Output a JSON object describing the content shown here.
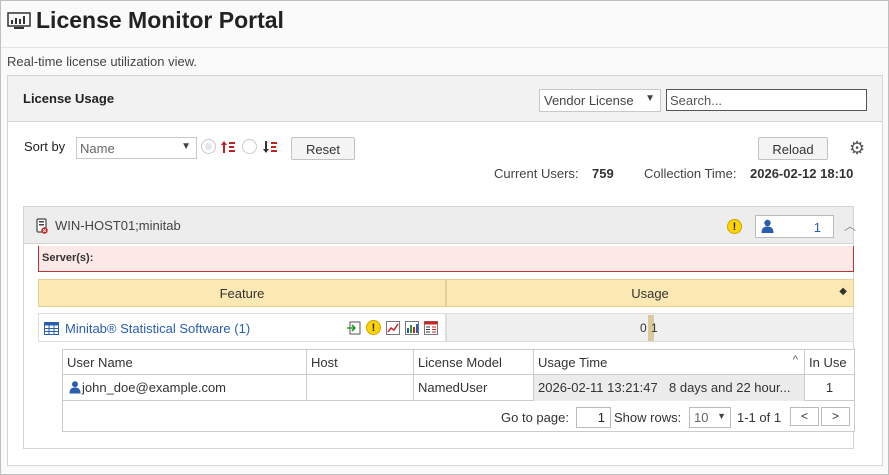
{
  "header": {
    "title": "License Monitor Portal",
    "subtitle": "Real-time license utilization view."
  },
  "panel": {
    "title": "License Usage",
    "vendor_select": "Vendor License",
    "search_placeholder": "Search..."
  },
  "controls": {
    "sort_label": "Sort by",
    "sort_value": "Name",
    "reset_label": "Reset",
    "reload_label": "Reload"
  },
  "stats": {
    "current_users_label": "Current Users:",
    "current_users_value": "759",
    "collection_time_label": "Collection Time:",
    "collection_time_value": "2026-02-12 18:10"
  },
  "server": {
    "name": "WIN-HOST01;minitab",
    "user_count": "1",
    "servers_label": "Server(s):"
  },
  "features": {
    "columns": [
      "Feature",
      "Usage"
    ],
    "rows": [
      {
        "name": "Minitab® Statistical Software (1)",
        "usage_in_use": "0",
        "usage_total": "1"
      }
    ]
  },
  "user_table": {
    "columns": [
      "User Name",
      "Host",
      "License Model",
      "Usage Time",
      "In Use"
    ],
    "rows": [
      {
        "user": "john_doe@example.com",
        "host": "",
        "model": "NamedUser",
        "usage_start": "2026-02-11 13:21:47",
        "usage_duration": "8 days and 22 hour...",
        "in_use": "1"
      }
    ],
    "footer": {
      "go_to_page_label": "Go to page:",
      "page": "1",
      "show_rows_label": "Show rows:",
      "rows_value": "10",
      "range": "1-1 of 1",
      "prev": "<",
      "next": ">"
    }
  },
  "colors": {
    "accent_blue": "#2a5db0",
    "header_gold": "#fce8b2",
    "error_border": "#bb3333",
    "warning_yellow": "#ffd400"
  }
}
